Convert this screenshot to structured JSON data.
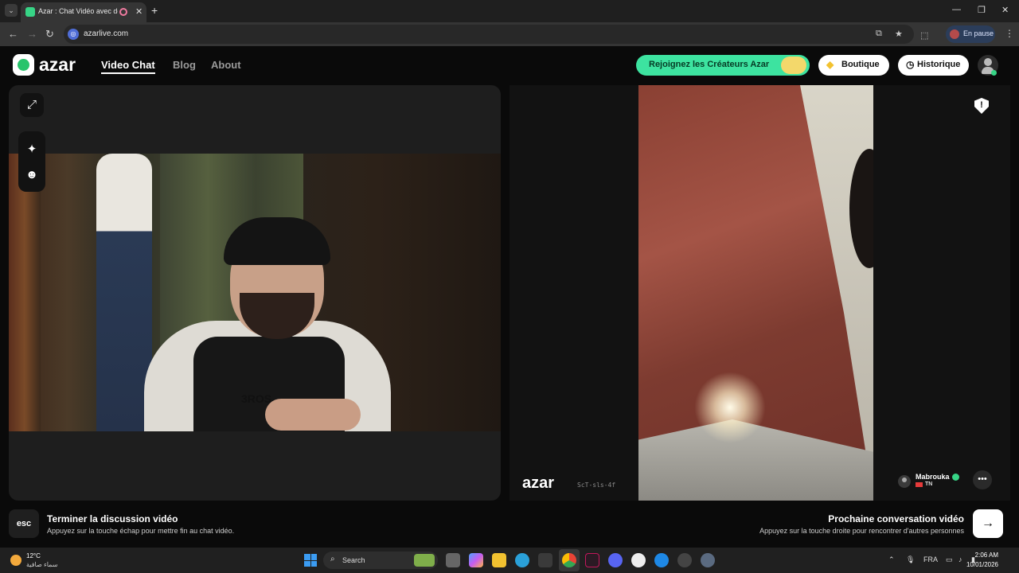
{
  "browser": {
    "tab_title": "Azar : Chat Vidéo avec de n",
    "tab_close": "✕",
    "new_tab": "+",
    "url": "azarlive.com",
    "profile_label": "En pause",
    "window_controls": {
      "minimize": "—",
      "maximize": "❐",
      "close": "✕"
    },
    "nav": {
      "back": "←",
      "forward": "→",
      "reload": "↻"
    },
    "icons": [
      "tab-list-icon",
      "recording-icon",
      "install-app-icon",
      "bookmark-star-icon",
      "extensions-icon",
      "menu-dots-icon"
    ]
  },
  "header": {
    "logo_text": "azar",
    "nav": [
      {
        "label": "Video Chat",
        "active": true
      },
      {
        "label": "Blog",
        "active": false
      },
      {
        "label": "About",
        "active": false
      }
    ],
    "creators_button": "Rejoignez les Créateurs Azar",
    "shop_button": "Boutique",
    "history_button": "Historique"
  },
  "self_view": {
    "hoodie_print": "3ROS"
  },
  "partner": {
    "watermark_logo": "azar",
    "watermark_code": "ScT-sls-4f",
    "name": "Mabrouka",
    "country": "TN"
  },
  "bottom": {
    "esc_key": "esc",
    "end_title": "Terminer la discussion vidéo",
    "end_hint": "Appuyez sur la touche échap pour mettre fin au chat vidéo.",
    "next_title": "Prochaine conversation vidéo",
    "next_hint": "Appuyez sur la touche droite pour rencontrer d'autres personnes",
    "next_arrow": "→"
  },
  "taskbar": {
    "weather_temp": "12°C",
    "weather_desc": "سماء صافية",
    "search_label": "Search",
    "language": "FRA",
    "time": "2:06 AM",
    "date": "10/01/2026"
  },
  "colors": {
    "accent_green": "#3de3a0",
    "brand_green": "#27c46b",
    "page_bg": "#0a0a0a",
    "panel_bg": "#1e1e1e"
  }
}
